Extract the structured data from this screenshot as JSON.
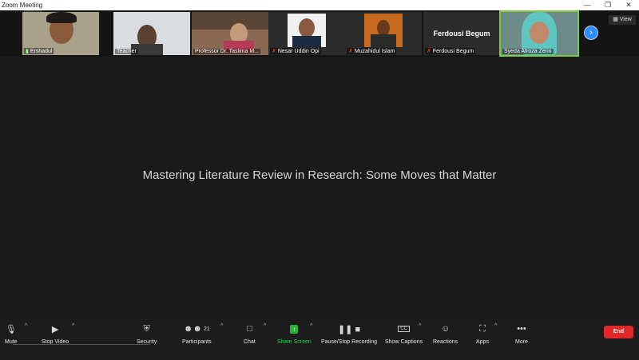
{
  "window": {
    "title": "Zoom Meeting"
  },
  "participants": [
    {
      "name": "Ershadul",
      "muted": false,
      "active": false,
      "video": true,
      "bg": "#a9a28a"
    },
    {
      "name": "Teacher",
      "muted": false,
      "active": false,
      "video": true,
      "bg": "#d9dde0"
    },
    {
      "name": "Professor Dr. Taslima M...",
      "muted": false,
      "active": false,
      "video": true,
      "bg": "#8a6a55"
    },
    {
      "name": "Nesar Uddin Opi",
      "muted": true,
      "active": false,
      "video": false,
      "bg": "#2b2b2b"
    },
    {
      "name": "Muzahidul Islam",
      "muted": true,
      "active": false,
      "video": false,
      "bg": "#2b2b2b"
    },
    {
      "name": "Ferdousi Begum",
      "muted": true,
      "active": false,
      "video": false,
      "bg": "#2b2b2b",
      "big_label": "Ferdousi Begum"
    },
    {
      "name": "Syeda Afroza Zerin",
      "muted": false,
      "active": true,
      "video": true,
      "bg": "#6d8a8a"
    }
  ],
  "view_label": "View",
  "shared_content": {
    "headline": "Mastering Literature Review in Research: Some Moves that Matter"
  },
  "toolbar": {
    "mute": "Mute",
    "stop_video": "Stop Video",
    "security": "Security",
    "participants": "Participants",
    "participants_count": "21",
    "chat": "Chat",
    "share_screen": "Share Screen",
    "recording": "Pause/Stop Recording",
    "captions": "Show Captions",
    "captions_badge": "CC",
    "reactions": "Reactions",
    "apps": "Apps",
    "more": "More",
    "end": "End"
  },
  "colors": {
    "accent_blue": "#2d8cff",
    "share_green": "#25b33c",
    "end_red": "#e02828",
    "active_speaker": "#7fcb3b"
  }
}
